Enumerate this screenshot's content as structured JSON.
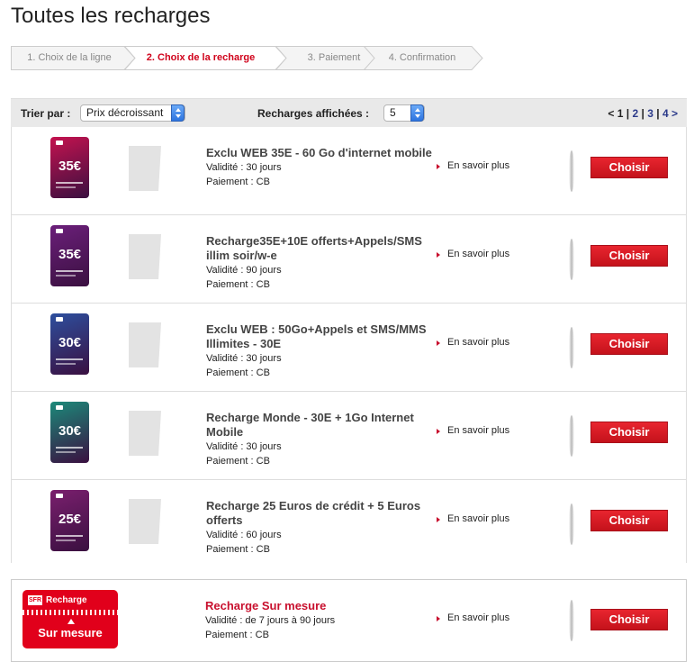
{
  "page": {
    "title": "Toutes les recharges"
  },
  "steps": [
    {
      "label": "1. Choix de la ligne",
      "active": false
    },
    {
      "label": "2. Choix de la recharge",
      "active": true
    },
    {
      "label": "3. Paiement",
      "active": false
    },
    {
      "label": "4. Confirmation",
      "active": false
    }
  ],
  "sortbar": {
    "sort_label": "Trier par :",
    "sort_value": "Prix décroissant",
    "count_label": "Recharges affichées :",
    "count_value": "5",
    "pager": {
      "prev": "<",
      "current": "1",
      "pages": [
        "2",
        "3",
        "4"
      ],
      "next": ">",
      "sep": "|"
    }
  },
  "offers": [
    {
      "title": "Exclu WEB 35E - 60 Go d'internet mobile",
      "validity": "Validité : 30 jours",
      "payment": "Paiement : CB",
      "card_price": "35€",
      "card_color": "#c4124f",
      "more": "En savoir plus",
      "button": "Choisir"
    },
    {
      "title": "Recharge35E+10E offerts+Appels/SMS illim soir/w-e",
      "validity": "Validité : 90 jours",
      "payment": "Paiement : CB",
      "card_price": "35€",
      "card_color": "#6b1f7a",
      "more": "En savoir plus",
      "button": "Choisir"
    },
    {
      "title": "Exclu WEB : 50Go+Appels et SMS/MMS Illimites - 30E",
      "validity": "Validité : 30 jours",
      "payment": "Paiement : CB",
      "card_price": "30€",
      "card_color": "#2d4f9e",
      "more": "En savoir plus",
      "button": "Choisir"
    },
    {
      "title": "Recharge Monde - 30E + 1Go Internet Mobile",
      "validity": "Validité : 30 jours",
      "payment": "Paiement : CB",
      "card_price": "30€",
      "card_color": "#1c8a7a",
      "more": "En savoir plus",
      "button": "Choisir"
    },
    {
      "title": "Recharge 25 Euros de crédit + 5 Euros offerts",
      "validity": "Validité : 60 jours",
      "payment": "Paiement : CB",
      "card_price": "25€",
      "card_color": "#7a1f6e",
      "more": "En savoir plus",
      "button": "Choisir"
    }
  ],
  "custom": {
    "card_logo": "SFR",
    "card_label": "Recharge",
    "card_big": "Sur mesure",
    "title": "Recharge Sur mesure",
    "validity": "Validité : de 7 jours à 90 jours",
    "payment": "Paiement : CB",
    "more": "En savoir plus",
    "button": "Choisir"
  },
  "colors": {
    "accent": "#d0021b",
    "link": "#2b3a8a"
  }
}
